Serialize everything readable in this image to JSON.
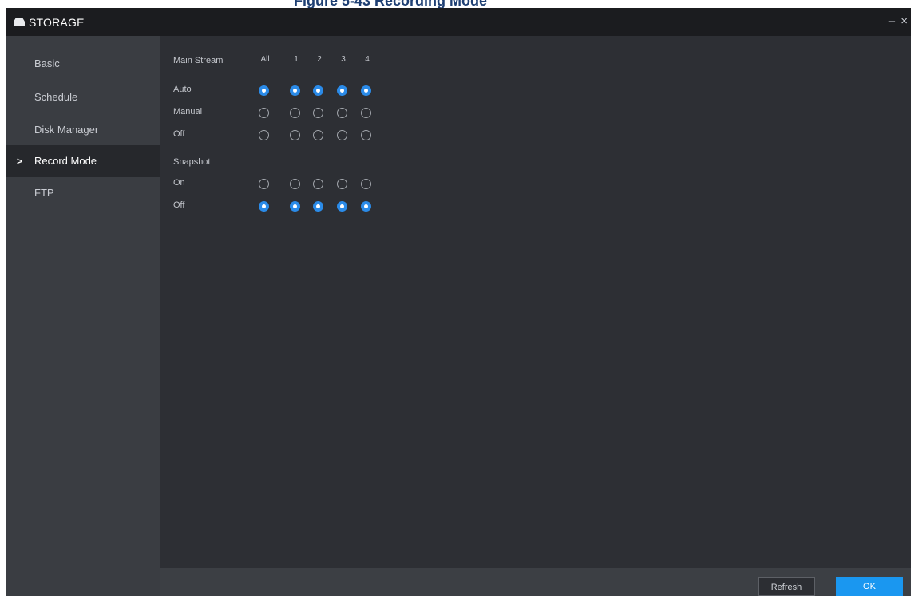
{
  "document": {
    "caption": "Figure 5-43 Recording Mode"
  },
  "window": {
    "title": "STORAGE",
    "minimize_label": "–",
    "close_label": "×"
  },
  "sidebar": {
    "items": [
      {
        "label": "Basic",
        "active": false
      },
      {
        "label": "Schedule",
        "active": false
      },
      {
        "label": "Disk Manager",
        "active": false
      },
      {
        "label": "Record Mode",
        "active": true
      },
      {
        "label": "FTP",
        "active": false
      }
    ],
    "active_marker": ">"
  },
  "record_mode": {
    "main_stream_label": "Main Stream",
    "columns": [
      "All",
      "1",
      "2",
      "3",
      "4"
    ],
    "main_stream_rows": [
      {
        "label": "Auto",
        "selected": [
          true,
          true,
          true,
          true,
          true
        ]
      },
      {
        "label": "Manual",
        "selected": [
          false,
          false,
          false,
          false,
          false
        ]
      },
      {
        "label": "Off",
        "selected": [
          false,
          false,
          false,
          false,
          false
        ]
      }
    ],
    "snapshot_label": "Snapshot",
    "snapshot_rows": [
      {
        "label": "On",
        "selected": [
          false,
          false,
          false,
          false,
          false
        ]
      },
      {
        "label": "Off",
        "selected": [
          true,
          true,
          true,
          true,
          true
        ]
      }
    ]
  },
  "footer": {
    "refresh_label": "Refresh",
    "ok_label": "OK"
  },
  "colors": {
    "accent": "#1a97f0",
    "radio_selected": "#2b8be8",
    "titlebar": "#1b1c1f",
    "sidebar": "#3a3d42",
    "content": "#2d2f34"
  }
}
